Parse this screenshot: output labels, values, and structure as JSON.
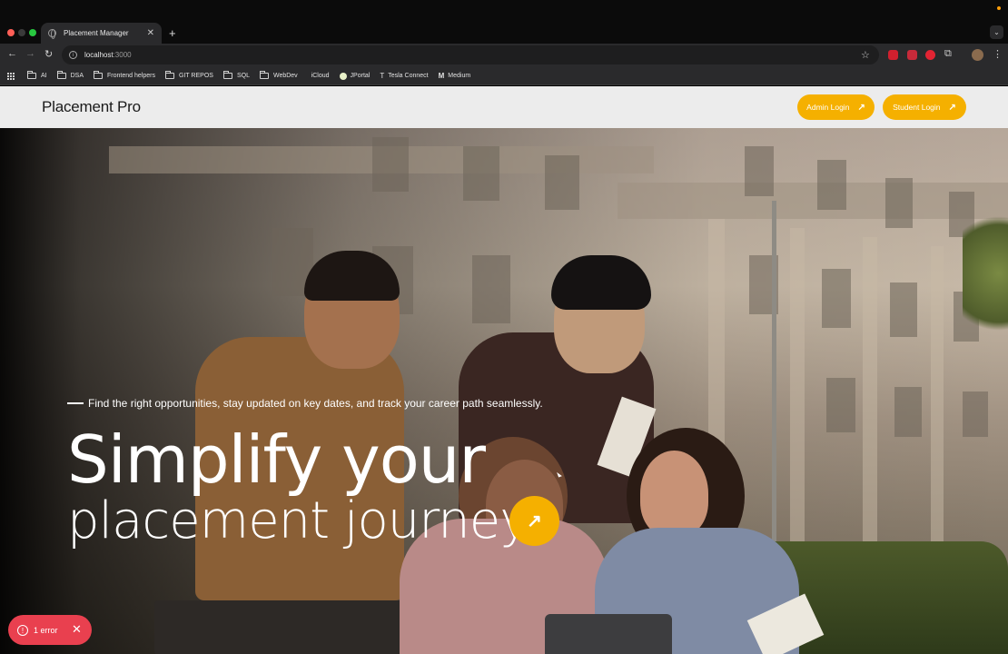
{
  "browser": {
    "tab_title": "Placement Manager",
    "tab_close": "✕",
    "new_tab": "+",
    "url_host": "localhost",
    "url_port": ":3000",
    "bookmarks": [
      {
        "label": "AI",
        "type": "folder"
      },
      {
        "label": "DSA",
        "type": "folder"
      },
      {
        "label": "Frontend helpers",
        "type": "folder"
      },
      {
        "label": "GIT REPOS",
        "type": "folder"
      },
      {
        "label": "SQL",
        "type": "folder"
      },
      {
        "label": "WebDev",
        "type": "folder"
      },
      {
        "label": "iCloud",
        "type": "site"
      },
      {
        "label": "JPortal",
        "type": "site"
      },
      {
        "label": "Tesla Connect",
        "type": "site"
      },
      {
        "label": "Medium",
        "type": "site"
      }
    ]
  },
  "header": {
    "brand": "Placement Pro",
    "admin_login": "Admin Login",
    "student_login": "Student Login",
    "arrow": "↗"
  },
  "hero": {
    "tagline": "Find the right opportunities, stay updated on key dates, and track your career path seamlessly.",
    "title_line1": "Simplify your",
    "title_line2": "placement journey",
    "cta_arrow": "↗"
  },
  "error_badge": {
    "label": "1 error",
    "icon": "!",
    "close": "✕"
  },
  "colors": {
    "accent": "#f5b000",
    "error": "#e9404f",
    "header_bg": "#ececec"
  }
}
